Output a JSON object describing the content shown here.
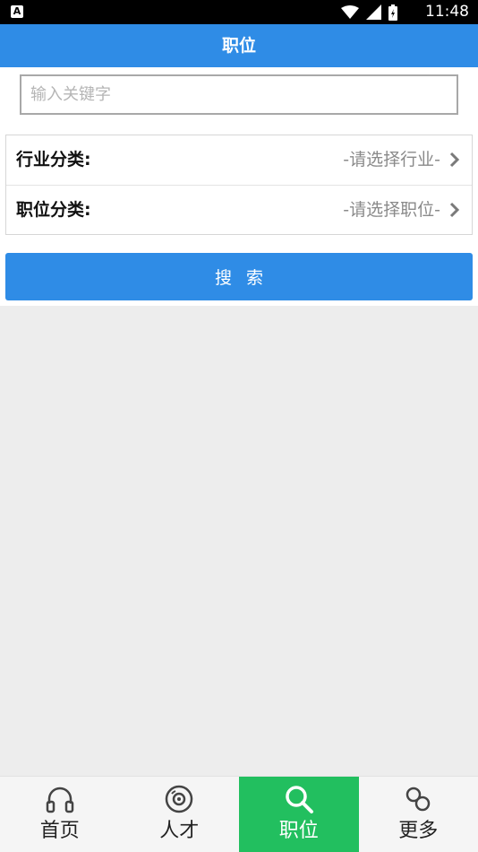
{
  "status_bar": {
    "time": "11:48",
    "notification_glyph": "A"
  },
  "header": {
    "title": "职位"
  },
  "search": {
    "placeholder": "输入关键字",
    "value": ""
  },
  "filters": [
    {
      "label": "行业分类:",
      "value": "-请选择行业-"
    },
    {
      "label": "职位分类:",
      "value": "-请选择职位-"
    }
  ],
  "search_button": {
    "label": "搜索"
  },
  "tabs": [
    {
      "label": "首页",
      "icon": "headphones-icon",
      "active": false
    },
    {
      "label": "人才",
      "icon": "disc-icon",
      "active": false
    },
    {
      "label": "职位",
      "icon": "search-icon",
      "active": true
    },
    {
      "label": "更多",
      "icon": "link-icon",
      "active": false
    }
  ],
  "colors": {
    "header": "#2f8ce6",
    "button": "#2f8ce6",
    "active_tab": "#22bf5f",
    "background": "#ededed"
  }
}
